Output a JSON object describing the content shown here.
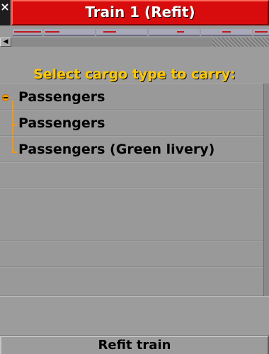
{
  "window": {
    "close_glyph": "×",
    "title": "Train 1 (Refit)"
  },
  "header": "Select cargo type to carry:",
  "cargo_list": {
    "group_label": "Passengers",
    "items": [
      {
        "label": "Passengers"
      },
      {
        "label": "Passengers (Green livery)"
      }
    ]
  },
  "button": {
    "label": "Refit train"
  },
  "colors": {
    "title_bar": "#d80c0c",
    "header_text": "#ffc800",
    "panel": "#9c9c9c",
    "tree_line": "#ff9800"
  },
  "icons": {
    "close": "close-icon",
    "collapse": "collapse-icon",
    "scroll_left": "arrow-left-icon"
  }
}
